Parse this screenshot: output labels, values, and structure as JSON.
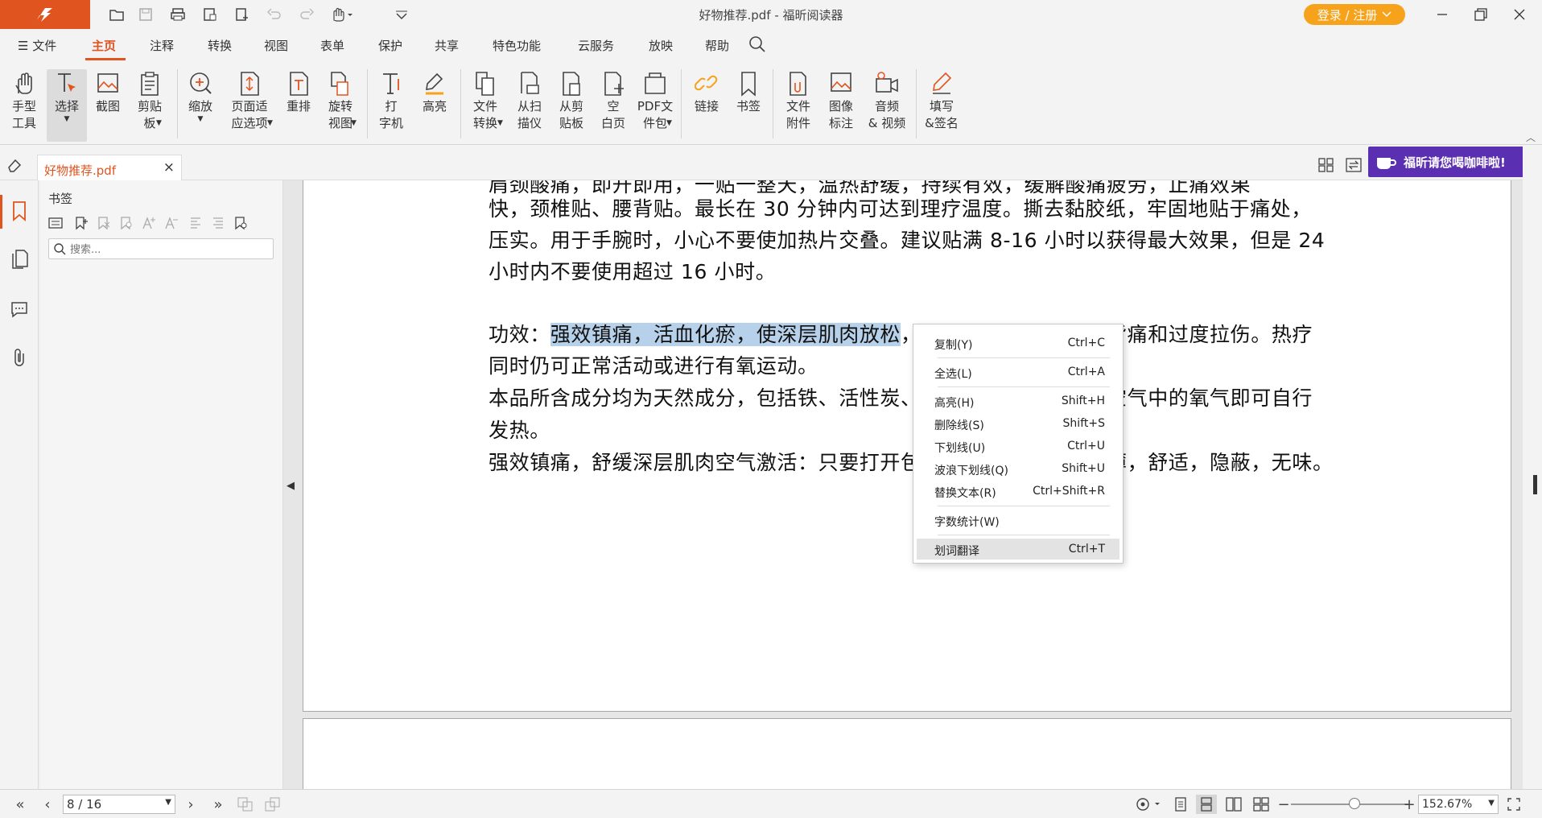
{
  "app": {
    "title": "好物推荐.pdf - 福昕阅读器",
    "login_label": "登录 / 注册"
  },
  "menu": {
    "file": "文件",
    "items": [
      "主页",
      "注释",
      "转换",
      "视图",
      "表单",
      "保护",
      "共享",
      "特色功能",
      "云服务",
      "放映",
      "帮助"
    ],
    "active": "主页"
  },
  "ribbon": {
    "tools": [
      {
        "label": "手型\n工具",
        "icon": "hand-icon"
      },
      {
        "label": "选择",
        "icon": "select-text-icon"
      },
      {
        "label": "截图",
        "icon": "screenshot-icon"
      },
      {
        "label": "剪贴\n板",
        "icon": "clipboard-icon"
      },
      {
        "label": "缩放",
        "icon": "zoom-icon"
      },
      {
        "label": "页面适\n应选项",
        "icon": "fit-page-icon"
      },
      {
        "label": "重排",
        "icon": "reflow-icon"
      },
      {
        "label": "旋转\n视图",
        "icon": "rotate-view-icon"
      },
      {
        "label": "打\n字机",
        "icon": "typewriter-icon"
      },
      {
        "label": "高亮",
        "icon": "highlight-icon"
      },
      {
        "label": "文件\n转换",
        "icon": "file-convert-icon"
      },
      {
        "label": "从扫\n描仪",
        "icon": "scanner-icon"
      },
      {
        "label": "从剪\n贴板",
        "icon": "from-clipboard-icon"
      },
      {
        "label": "空\n白页",
        "icon": "blank-page-icon"
      },
      {
        "label": "PDF文\n件包",
        "icon": "pdf-package-icon"
      },
      {
        "label": "链接",
        "icon": "link-icon"
      },
      {
        "label": "书签",
        "icon": "bookmark-icon"
      },
      {
        "label": "文件\n附件",
        "icon": "file-attachment-icon"
      },
      {
        "label": "图像\n标注",
        "icon": "image-annotation-icon"
      },
      {
        "label": "音频\n& 视频",
        "icon": "audio-video-icon"
      },
      {
        "label": "填写\n&签名",
        "icon": "fill-sign-icon"
      }
    ]
  },
  "tab": {
    "filename": "好物推荐.pdf",
    "close": "×",
    "promo": "福昕请您喝咖啡啦!"
  },
  "bookmarks": {
    "title": "书签",
    "search_placeholder": "搜索..."
  },
  "document": {
    "lines": [
      "快，颈椎贴、腰背贴。最长在 30 分钟内可达到理疗温度。撕去黏胶纸，牢固地贴于痛处，",
      "压实。用于手腕时，小心不要使加热片交叠。建议贴满 8-16 小时以获得最大效果，但是 24",
      "小时内不要使用超过 16 小时。"
    ],
    "effect_label": "功效：",
    "effect_selected": "强效镇痛，活血化瘀，使深层肌肉放松",
    "effect_rest": "，暂时舒缓肌肉引起的背痛和过度拉伤。热疗",
    "line5": "同时仍可正常活动或进行有氧运动。",
    "line6": "本品所含成分均为天然成分，包括铁、活性炭、盐、水、蛭石，接触空气中的氧气即可自行",
    "line7": "发热。",
    "line8": "强效镇痛，舒缓深层肌肉空气激活：只要打开包装，就开始发热，轻薄，舒适，隐蔽，无味。"
  },
  "context_menu": {
    "items": [
      {
        "label": "复制(Y)",
        "shortcut": "Ctrl+C"
      },
      {
        "label": "全选(L)",
        "shortcut": "Ctrl+A"
      },
      {
        "label": "高亮(H)",
        "shortcut": "Shift+H"
      },
      {
        "label": "删除线(S)",
        "shortcut": "Shift+S"
      },
      {
        "label": "下划线(U)",
        "shortcut": "Ctrl+U"
      },
      {
        "label": "波浪下划线(Q)",
        "shortcut": "Shift+U"
      },
      {
        "label": "替换文本(R)",
        "shortcut": "Ctrl+Shift+R"
      },
      {
        "label": "字数统计(W)",
        "shortcut": ""
      },
      {
        "label": "划词翻译",
        "shortcut": "Ctrl+T"
      }
    ]
  },
  "status": {
    "page": "8 / 16",
    "zoom": "152.67%",
    "zoom_fraction": 0.5
  },
  "colors": {
    "accent": "#e0541f",
    "login": "#f7a21b",
    "promo": "#5b2fb1",
    "selection": "#b7d1ea"
  }
}
